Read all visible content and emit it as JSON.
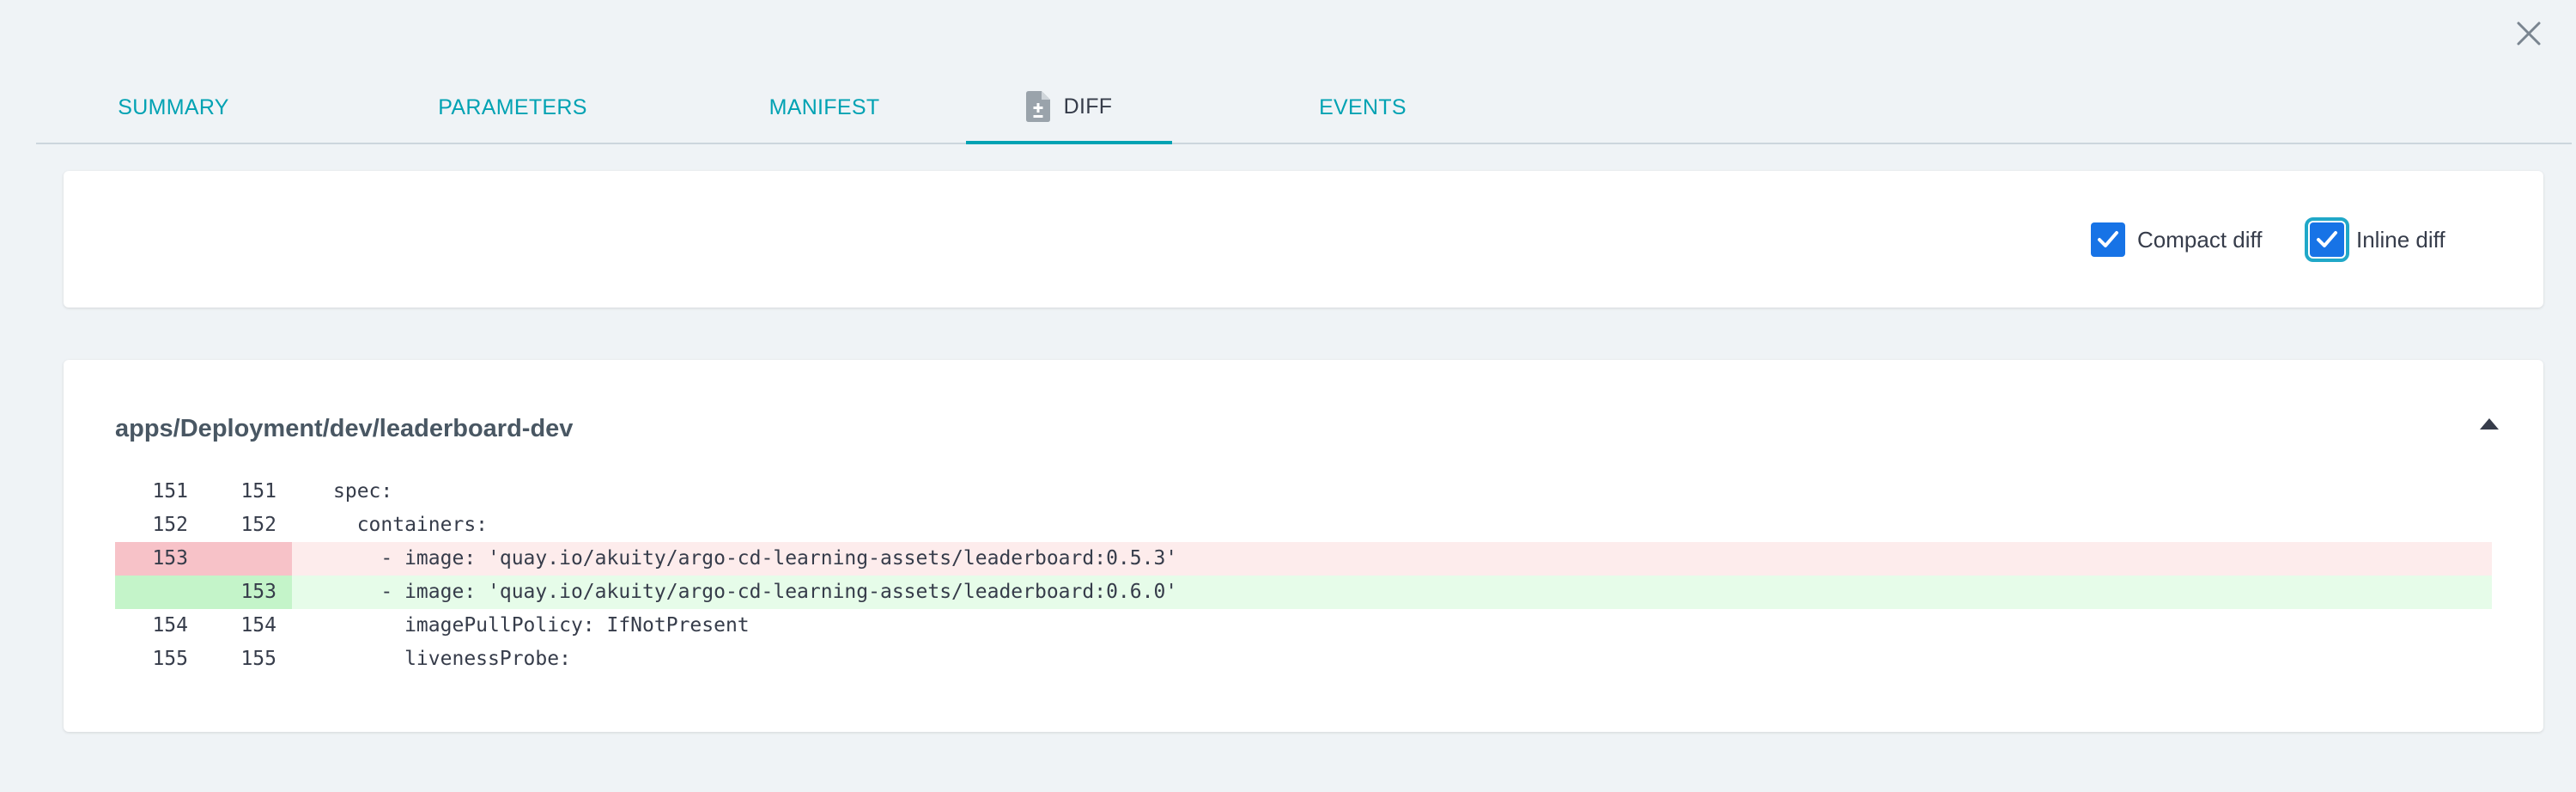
{
  "tabs": [
    {
      "label": "SUMMARY"
    },
    {
      "label": "PARAMETERS"
    },
    {
      "label": "MANIFEST"
    },
    {
      "label": "DIFF",
      "icon": "file-diff-icon",
      "active": true
    },
    {
      "label": "EVENTS"
    }
  ],
  "options": {
    "compact_diff": {
      "label": "Compact diff",
      "checked": true
    },
    "inline_diff": {
      "label": "Inline diff",
      "checked": true,
      "focused": true
    }
  },
  "diff": {
    "resource": "apps/Deployment/dev/leaderboard-dev",
    "lines": [
      {
        "old": "151",
        "new": "151",
        "type": "context",
        "text": "spec:"
      },
      {
        "old": "152",
        "new": "152",
        "type": "context",
        "text": "  containers:"
      },
      {
        "old": "153",
        "new": "",
        "type": "removed",
        "text": "    - image: 'quay.io/akuity/argo-cd-learning-assets/leaderboard:0.5.3'"
      },
      {
        "old": "",
        "new": "153",
        "type": "added",
        "text": "    - image: 'quay.io/akuity/argo-cd-learning-assets/leaderboard:0.6.0'"
      },
      {
        "old": "154",
        "new": "154",
        "type": "context",
        "text": "      imagePullPolicy: IfNotPresent"
      },
      {
        "old": "155",
        "new": "155",
        "type": "context",
        "text": "      livenessProbe:"
      }
    ]
  },
  "colors": {
    "accent": "#00a2b3",
    "checkbox": "#1773e6",
    "removed_bg": "#fdecec",
    "added_bg": "#e6fce9"
  }
}
